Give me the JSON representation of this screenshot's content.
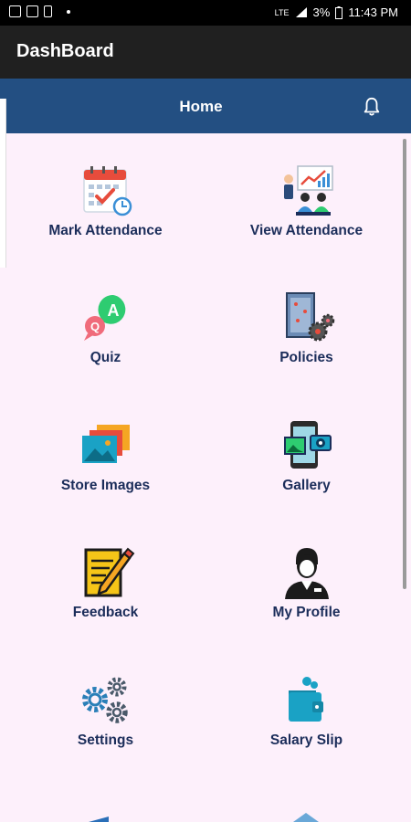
{
  "status_bar": {
    "time": "11:43 PM",
    "battery": "3%",
    "network": "LTE"
  },
  "app_bar": {
    "title": "DashBoard"
  },
  "home_bar": {
    "title": "Home"
  },
  "tiles": [
    {
      "label": "Mark Attendance",
      "icon": "calendar-check-icon"
    },
    {
      "label": "View Attendance",
      "icon": "presentation-chart-icon"
    },
    {
      "label": "Quiz",
      "icon": "quiz-bubbles-icon"
    },
    {
      "label": "Policies",
      "icon": "policies-gears-icon"
    },
    {
      "label": "Store Images",
      "icon": "photo-stack-icon"
    },
    {
      "label": "Gallery",
      "icon": "phone-gallery-icon"
    },
    {
      "label": "Feedback",
      "icon": "pencil-paper-icon"
    },
    {
      "label": "My Profile",
      "icon": "user-profile-icon"
    },
    {
      "label": "Settings",
      "icon": "settings-gears-icon"
    },
    {
      "label": "Salary Slip",
      "icon": "wallet-icon"
    }
  ]
}
